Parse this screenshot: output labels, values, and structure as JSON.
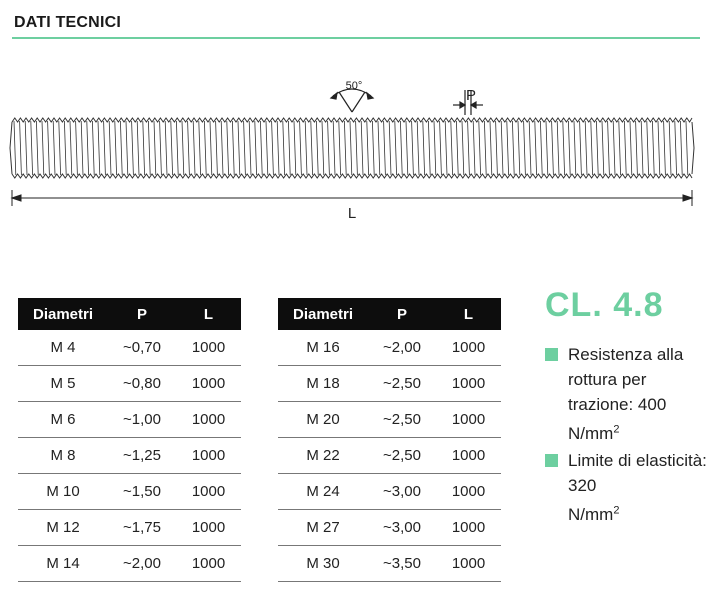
{
  "header": {
    "title": "DATI TECNICI"
  },
  "drawing": {
    "angle_label": "50°",
    "pitch_label": "P",
    "length_label": "L"
  },
  "tables": [
    {
      "headers": [
        "Diametri",
        "P",
        "L"
      ],
      "rows": [
        [
          "M 4",
          "~0,70",
          "1000"
        ],
        [
          "M 5",
          "~0,80",
          "1000"
        ],
        [
          "M 6",
          "~1,00",
          "1000"
        ],
        [
          "M 8",
          "~1,25",
          "1000"
        ],
        [
          "M 10",
          "~1,50",
          "1000"
        ],
        [
          "M 12",
          "~1,75",
          "1000"
        ],
        [
          "M 14",
          "~2,00",
          "1000"
        ]
      ]
    },
    {
      "headers": [
        "Diametri",
        "P",
        "L"
      ],
      "rows": [
        [
          "M 16",
          "~2,00",
          "1000"
        ],
        [
          "M 18",
          "~2,50",
          "1000"
        ],
        [
          "M 20",
          "~2,50",
          "1000"
        ],
        [
          "M 22",
          "~2,50",
          "1000"
        ],
        [
          "M 24",
          "~3,00",
          "1000"
        ],
        [
          "M 27",
          "~3,00",
          "1000"
        ],
        [
          "M 30",
          "~3,50",
          "1000"
        ]
      ]
    }
  ],
  "class_info": {
    "title": "CL. 4.8",
    "properties": [
      {
        "text": "Resistenza alla rottura per trazione: 400",
        "unit": "N/mm",
        "exp": "2"
      },
      {
        "text": "Limite di elasticità: 320",
        "unit": "N/mm",
        "exp": "2"
      }
    ]
  },
  "colors": {
    "accent": "#6dcfa0",
    "header_bg": "#0d0d0d"
  }
}
